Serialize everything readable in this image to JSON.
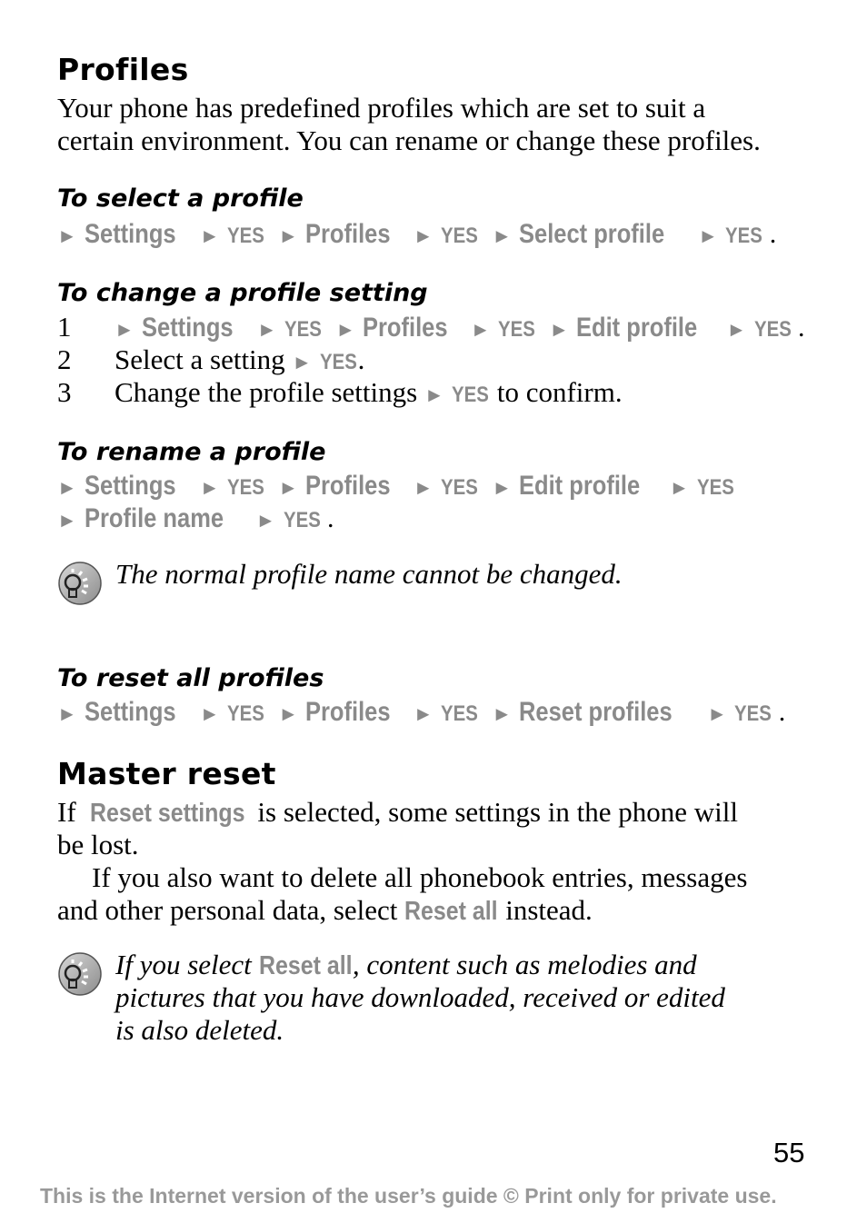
{
  "profiles": {
    "heading": "Profiles",
    "intro_line1": "Your phone has predefined profiles which are set to suit a",
    "intro_line2": "certain environment. You can rename or change these profiles."
  },
  "select_profile": {
    "heading": "To select a profile",
    "path": [
      "Settings",
      "YES",
      "Profiles",
      "YES",
      "Select profile",
      "YES"
    ]
  },
  "change_setting": {
    "heading": "To change a profile setting",
    "steps": [
      {
        "number": "1",
        "path": [
          "Settings",
          "YES",
          "Profiles",
          "YES",
          "Edit profile",
          "YES"
        ]
      },
      {
        "number": "2",
        "text": "Select a setting",
        "key": "YES",
        "suffix": "."
      },
      {
        "number": "3",
        "text": "Change the profile settings",
        "key": "YES",
        "suffix": " to confirm."
      }
    ]
  },
  "rename_profile": {
    "heading": "To rename a profile",
    "path_line1": [
      "Settings",
      "YES",
      "Profiles",
      "YES",
      "Edit profile",
      "YES"
    ],
    "path_line2": [
      "Profile name",
      "YES"
    ],
    "tip_icon": "lightbulb-tip-icon",
    "tip": "The normal profile name cannot be changed."
  },
  "reset_profiles": {
    "heading": "To reset all profiles",
    "path": [
      "Settings",
      "YES",
      "Profiles",
      "YES",
      "Reset profiles",
      "YES"
    ]
  },
  "master_reset": {
    "heading": "Master reset",
    "p1_prefix": "If ",
    "p1_menu": "Reset settings",
    "p1_suffix": " is selected, some settings in the phone will",
    "p1_line2": "be lost.",
    "p2_line1": "If you also want to delete all phonebook entries, messages",
    "p2_prefix": "and other personal data, select ",
    "p2_menu": "Reset all",
    "p2_suffix": " instead.",
    "tip_icon": "lightbulb-tip-icon",
    "tip_prefix": "If you select ",
    "tip_menu": "Reset all",
    "tip_suffix": ", content such as melodies and",
    "tip_line2": "pictures that you have downloaded, received or edited",
    "tip_line3": "is also deleted."
  },
  "page_number": "55",
  "footer": "This is the Internet version of the user’s guide © Print only for private use.",
  "arrow_glyph": "►"
}
